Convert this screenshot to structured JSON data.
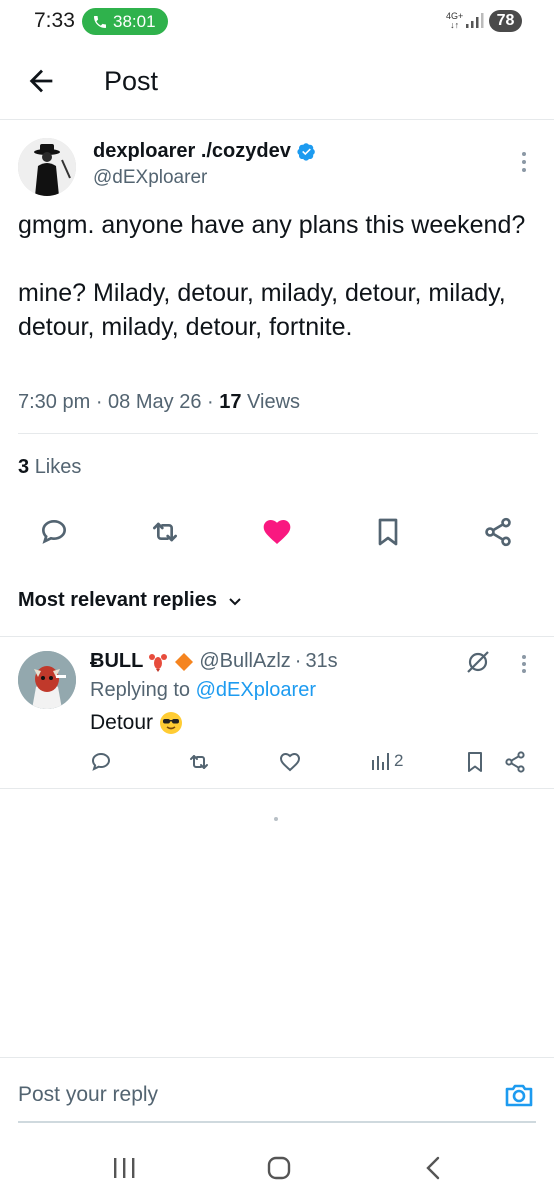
{
  "status_bar": {
    "time": "7:33",
    "call_timer": "38:01",
    "network": "4G+",
    "battery": "78"
  },
  "header": {
    "title": "Post"
  },
  "post": {
    "author_name": "dexploarer ./cozydev",
    "author_handle": "@dEXploarer",
    "text_line1": "gmgm. anyone have any plans this weekend?",
    "text_line2": "mine? Milady, detour, milady, detour, milady, detour, milady, detour, fortnite.",
    "time": "7:30 pm",
    "date": "08 May 26",
    "views_count": "17",
    "views_label": "Views",
    "likes_count": "3",
    "likes_label": "Likes",
    "liked": true
  },
  "replies_sort": {
    "label": "Most relevant replies"
  },
  "reply": {
    "name": "ɃULL",
    "handle": "@BullAzlz",
    "age": "31s",
    "replying_prefix": "Replying to",
    "replying_to": "@dEXploarer",
    "text": "Detour",
    "views": "2"
  },
  "composer": {
    "placeholder": "Post your reply"
  },
  "colors": {
    "accent": "#1d9bf0",
    "like": "#f91880",
    "call_pill": "#2fb24c",
    "secondary_text": "#536471"
  }
}
